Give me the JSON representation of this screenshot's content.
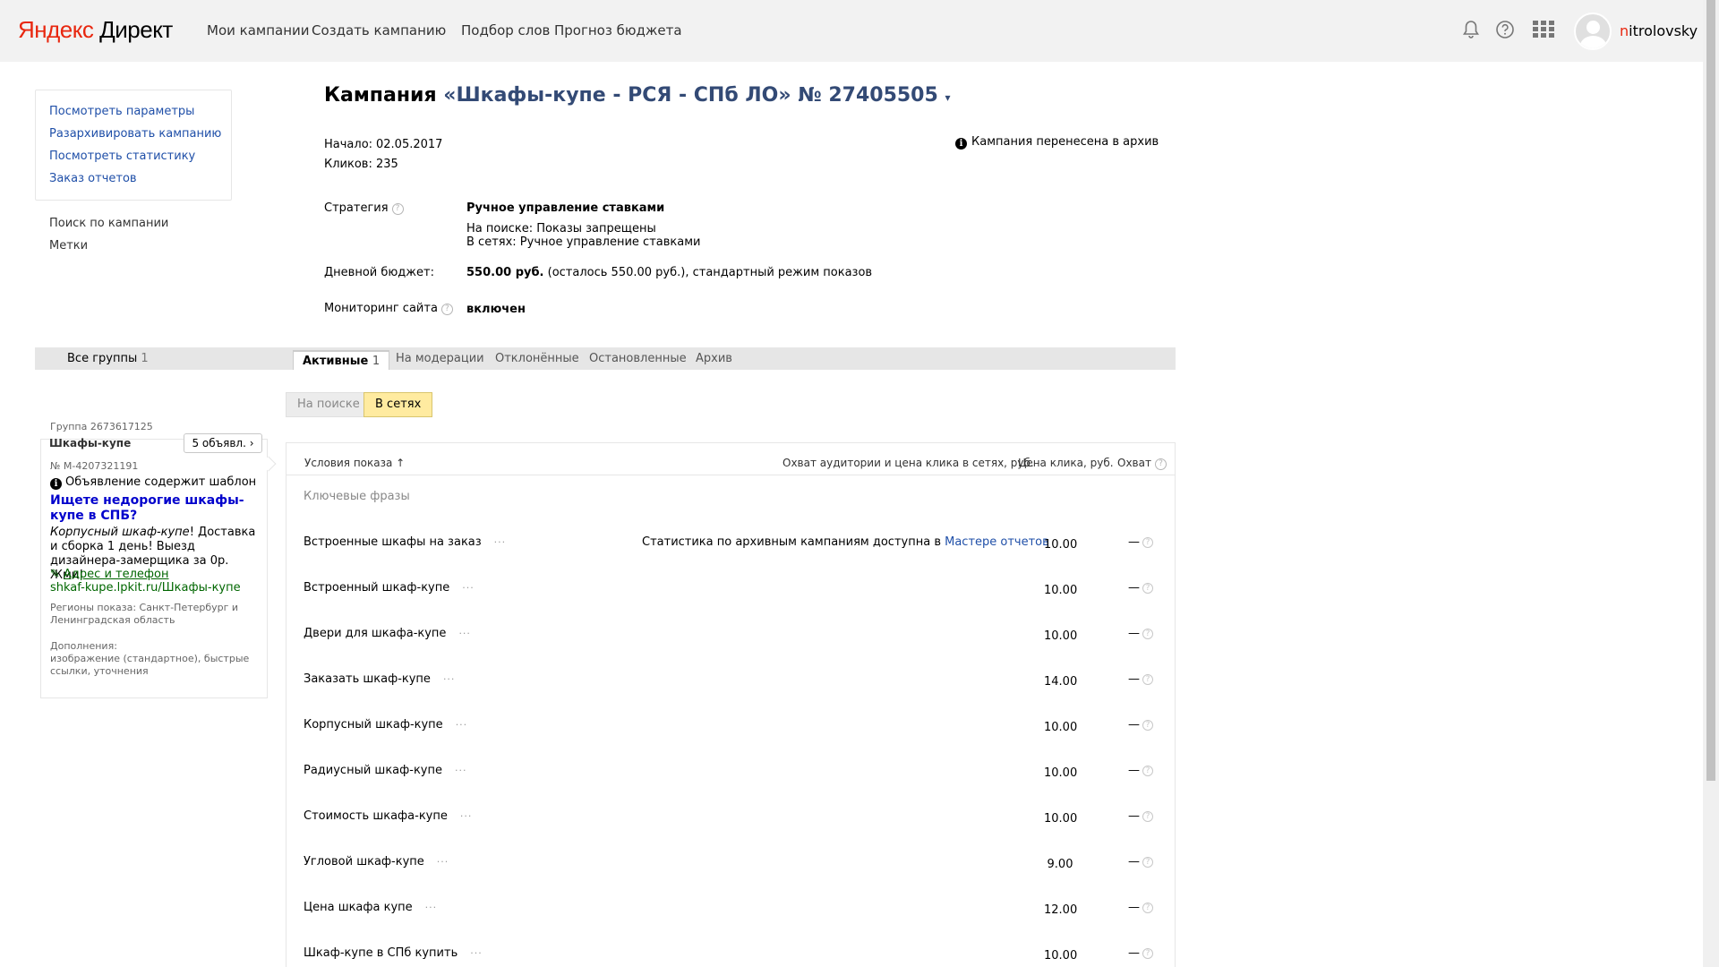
{
  "header": {
    "logo_ya": "Яндекс",
    "logo_rest": " Директ",
    "nav": [
      "Мои кампании",
      "Создать кампанию",
      "Подбор слов",
      "Прогноз бюджета"
    ],
    "username_first": "n",
    "username_rest": "itrolovsky"
  },
  "sidebar": {
    "box_links": [
      "Посмотреть параметры",
      "Разархивировать кампанию",
      "Посмотреть статистику",
      "Заказ отчетов"
    ],
    "plain_links": [
      "Поиск по кампании",
      "Метки"
    ]
  },
  "campaign": {
    "title_prefix": "Кампания ",
    "title_name": "«Шкафы-купе - РСЯ - СПб ЛО» № 27405505",
    "caret": "▾",
    "start_label": "Начало:",
    "start_value": "02.05.2017",
    "clicks_label": "Кликов:",
    "clicks_value": "235",
    "archive_note": "Кампания перенесена в архив",
    "strategy_label": "Стратегия",
    "strategy_value": "Ручное управление ставками",
    "strategy_search": "На поиске: Показы запрещены",
    "strategy_network": "В сетях: Ручное управление ставками",
    "budget_label": "Дневной бюджет:",
    "budget_value": "550.00 руб.",
    "budget_rest": " (осталось 550.00 руб.), стандартный режим показов",
    "monitoring_label": "Мониторинг сайта",
    "monitoring_value": "включен"
  },
  "tabs": {
    "all_groups": "Все группы",
    "all_groups_count": "1",
    "active": "Активные",
    "active_count": "1",
    "items": [
      "На модерации",
      "Отклонённые",
      "Остановленные",
      "Архив"
    ]
  },
  "toggle": {
    "search": "На поиске",
    "network": "В сетях",
    "selected": "В сетях"
  },
  "group": {
    "id_label": "Группа 2673617125",
    "name": "Шкафы-купе",
    "ads_button": "5 объявл.",
    "ad_number": "№ M-4207321191",
    "template_note": "Объявление содержит шаблон",
    "headline": "Ищете недорогие шкафы-купе в СПБ?",
    "text_italic": "Корпусный шкаф-купе",
    "text_rest": "! Доставка и сборка 1 день! Выезд дизайнера-замерщика за 0р. Жми!",
    "address_link": "Адрес и телефон",
    "display_url": "shkaf-kupe.lpkit.ru/Шкафы-купе",
    "regions": "Регионы показа: Санкт-Петербург и Ленинградская область",
    "extras_label": "Дополнения:",
    "extras": "изображение (стандартное), быстрые ссылки, уточнения"
  },
  "table": {
    "col_conditions": "Условия показа ↑",
    "col_coverage": "Охват аудитории и цена клика в сетях, руб.",
    "col_price": "Цена клика, руб.",
    "col_reach": "Охват",
    "section": "Ключевые фразы",
    "stats_note": "Статистика по архивным кампаниям доступна в ",
    "stats_link": "Мастере отчетов",
    "rows": [
      {
        "phrase": "Встроенные шкафы на заказ",
        "price": "10.00",
        "reach": "—"
      },
      {
        "phrase": "Встроенный шкаф-купе",
        "price": "10.00",
        "reach": "—"
      },
      {
        "phrase": "Двери для шкафа-купе",
        "price": "10.00",
        "reach": "—"
      },
      {
        "phrase": "Заказать шкаф-купе",
        "price": "14.00",
        "reach": "—"
      },
      {
        "phrase": "Корпусный шкаф-купе",
        "price": "10.00",
        "reach": "—"
      },
      {
        "phrase": "Радиусный шкаф-купе",
        "price": "10.00",
        "reach": "—"
      },
      {
        "phrase": "Стоимость шкафа-купе",
        "price": "10.00",
        "reach": "—"
      },
      {
        "phrase": "Угловой шкаф-купе",
        "price": "9.00",
        "reach": "—"
      },
      {
        "phrase": "Цена шкафа купе",
        "price": "12.00",
        "reach": "—"
      },
      {
        "phrase": "Шкаф-купе в СПб купить",
        "price": "10.00",
        "reach": "—"
      }
    ]
  },
  "icons": [
    "bell-icon",
    "help-icon",
    "apps-grid-icon",
    "info-icon",
    "pencil-icon",
    "chevron-right-icon"
  ],
  "colors": {
    "header_bg": "#f2f2f2",
    "link": "#1f4fa8",
    "logo_red": "#e8270f",
    "toggle_active": "#ffeba0",
    "ad_headline": "#0000cc",
    "ad_url": "#006600"
  }
}
